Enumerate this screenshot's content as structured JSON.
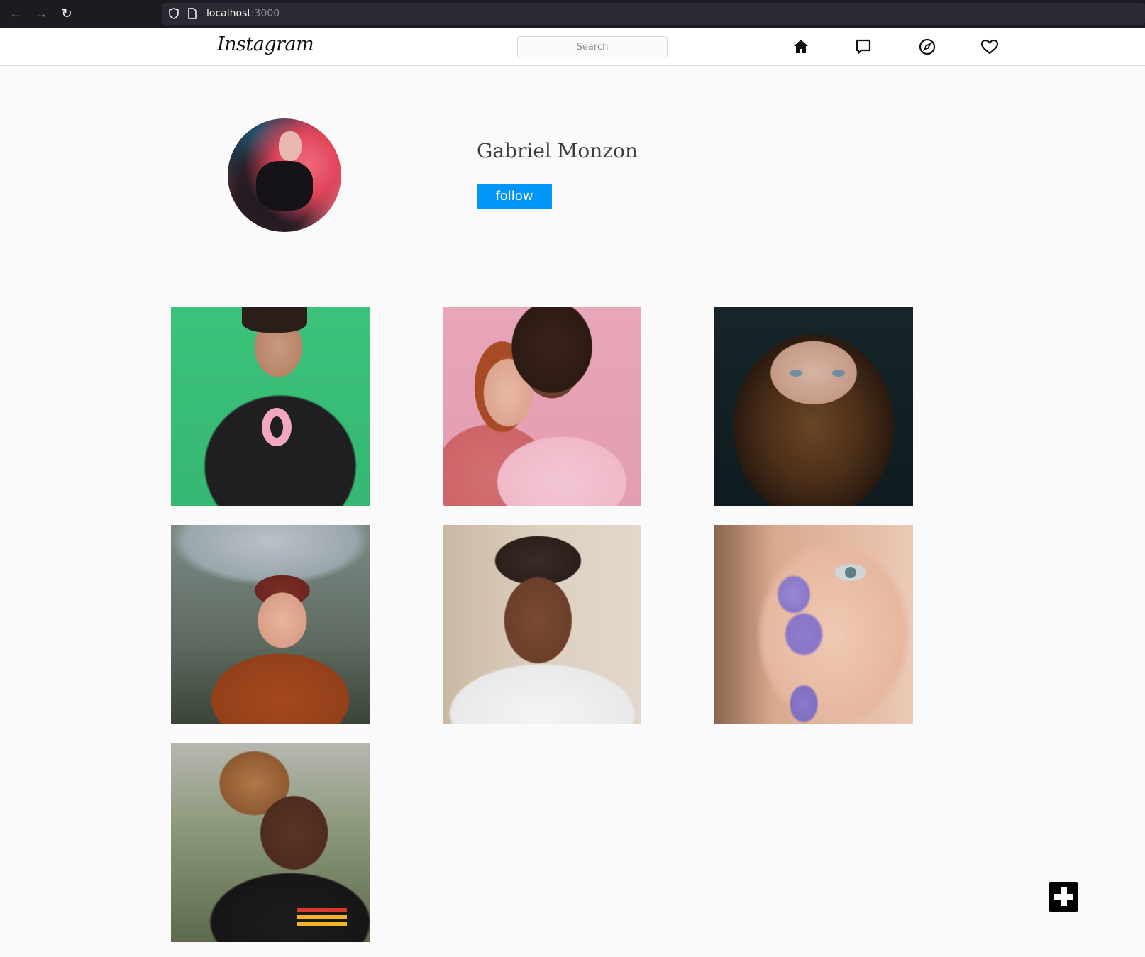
{
  "browser": {
    "url_host": "localhost",
    "url_port": ":3000"
  },
  "header": {
    "logo": "Instagram",
    "search_placeholder": "Search",
    "icons": [
      "home-icon",
      "message-icon",
      "explore-compass-icon",
      "heart-icon"
    ]
  },
  "profile": {
    "name": "Gabriel Monzon",
    "follow_label": "follow"
  },
  "posts": [
    {
      "id": "post-1",
      "subject": "man-green-background"
    },
    {
      "id": "post-2",
      "subject": "two-women-pink-background"
    },
    {
      "id": "post-3",
      "subject": "woman-paisley-scarf"
    },
    {
      "id": "post-4",
      "subject": "woman-umbrella"
    },
    {
      "id": "post-5",
      "subject": "woman-beaded-headpiece"
    },
    {
      "id": "post-6",
      "subject": "woman-flowers-face"
    },
    {
      "id": "post-7",
      "subject": "two-women-laughing"
    }
  ],
  "colors": {
    "accent": "#0095f6",
    "background": "#fafafa",
    "header_border": "#dbdbdb"
  }
}
